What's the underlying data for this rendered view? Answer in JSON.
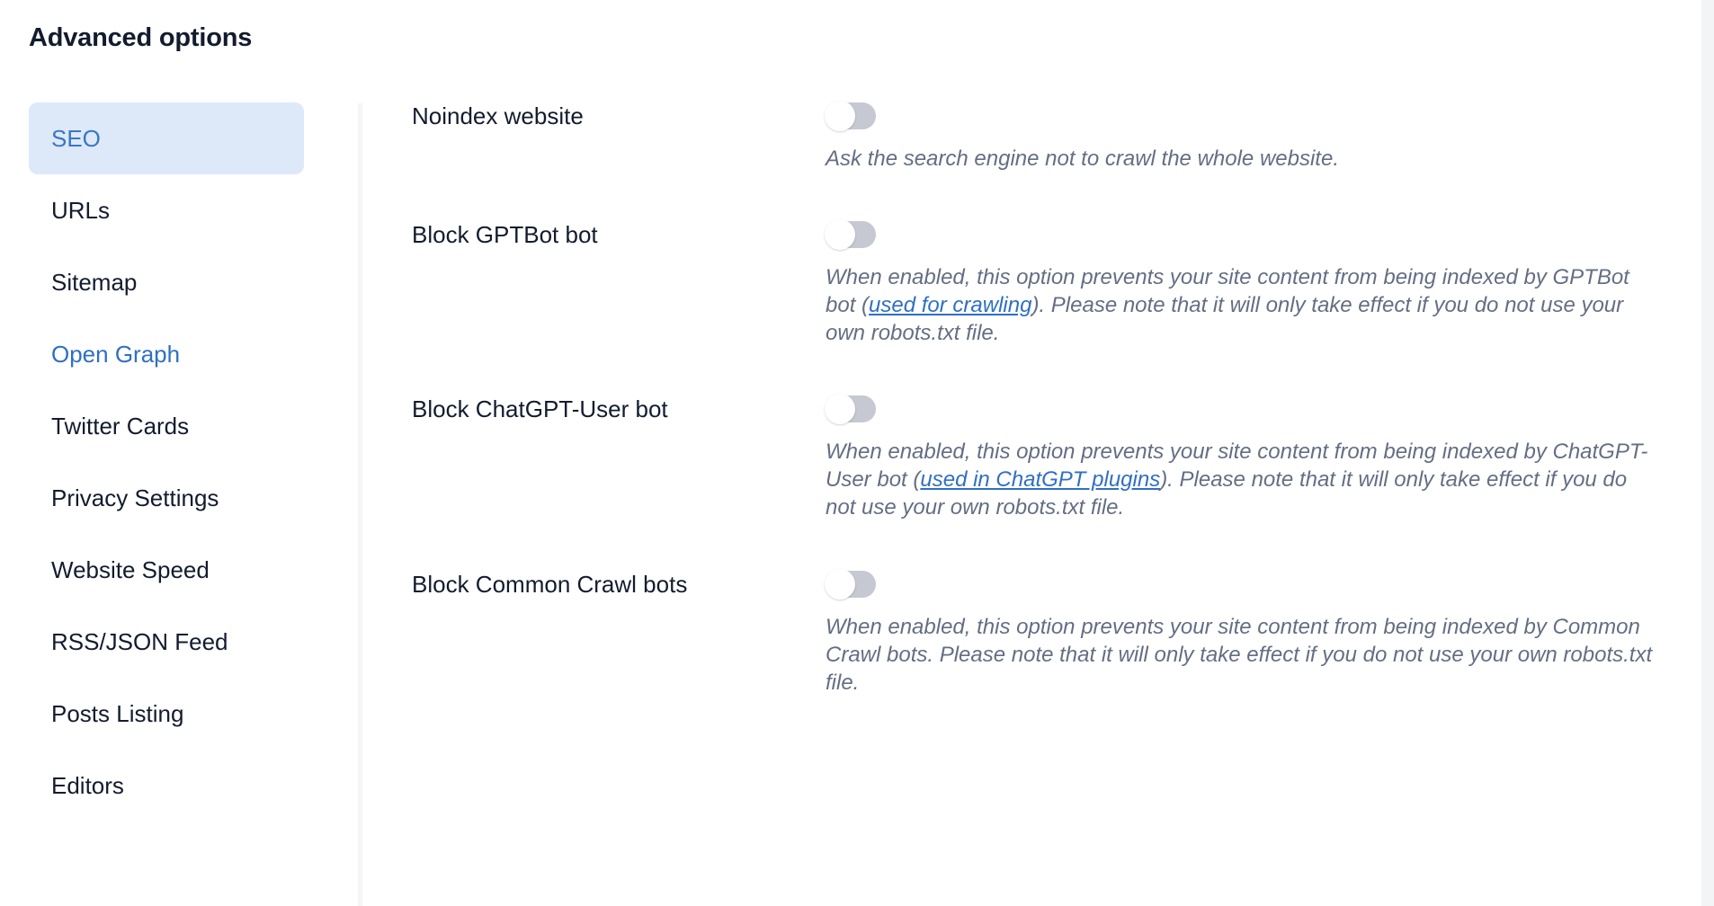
{
  "header": {
    "title": "Advanced options"
  },
  "colors": {
    "accent": "#2f6fc4",
    "active_pill_bg": "#dde9f9",
    "text": "#131c2e",
    "muted_text": "#646e83",
    "toggle_off_track": "#c6c9d1",
    "divider": "#f4f5f7"
  },
  "sidebar": {
    "items": [
      {
        "label": "SEO",
        "state": "active"
      },
      {
        "label": "URLs",
        "state": "default"
      },
      {
        "label": "Sitemap",
        "state": "default"
      },
      {
        "label": "Open Graph",
        "state": "hovered"
      },
      {
        "label": "Twitter Cards",
        "state": "default"
      },
      {
        "label": "Privacy Settings",
        "state": "default"
      },
      {
        "label": "Website Speed",
        "state": "default"
      },
      {
        "label": "RSS/JSON Feed",
        "state": "default"
      },
      {
        "label": "Posts Listing",
        "state": "default"
      },
      {
        "label": "Editors",
        "state": "default"
      }
    ]
  },
  "main": {
    "options": [
      {
        "label": "Noindex website",
        "toggle_state": "off",
        "description_before": "Ask the search engine not to crawl the whole website.",
        "link_text": "",
        "description_after": ""
      },
      {
        "label": "Block GPTBot bot",
        "toggle_state": "off",
        "description_before": "When enabled, this option prevents your site content from being indexed by GPTBot bot (",
        "link_text": "used for crawling",
        "description_after": "). Please note that it will only take effect if you do not use your own robots.txt file."
      },
      {
        "label": "Block ChatGPT-User bot",
        "toggle_state": "off",
        "description_before": "When enabled, this option prevents your site content from being indexed by ChatGPT-User bot (",
        "link_text": "used in ChatGPT plugins",
        "description_after": "). Please note that it will only take effect if you do not use your own robots.txt file."
      },
      {
        "label": "Block Common Crawl bots",
        "toggle_state": "off",
        "description_before": "When enabled, this option prevents your site content from being indexed by Common Crawl bots. Please note that it will only take effect if you do not use your own robots.txt file.",
        "link_text": "",
        "description_after": ""
      }
    ]
  }
}
